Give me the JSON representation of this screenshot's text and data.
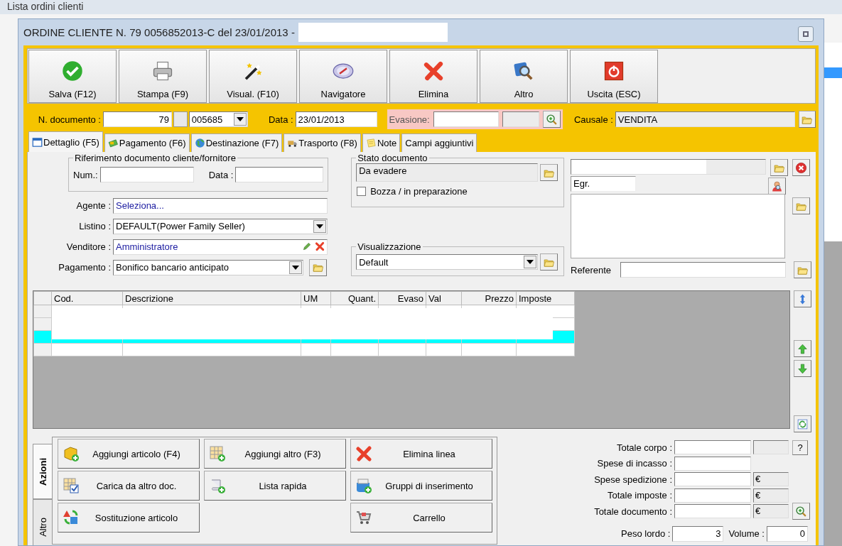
{
  "background_window": {
    "title": "Lista ordini clienti"
  },
  "window": {
    "title": "ORDINE CLIENTE N. 79 0056852013-C del 23/01/2013 -"
  },
  "toolbar": [
    {
      "label": "Salva (F12)"
    },
    {
      "label": "Stampa (F9)"
    },
    {
      "label": "Visual. (F10)"
    },
    {
      "label": "Navigatore"
    },
    {
      "label": "Elimina"
    },
    {
      "label": "Altro"
    },
    {
      "label": "Uscita (ESC)"
    }
  ],
  "header": {
    "n_documento_label": "N. documento :",
    "n_documento": "79",
    "serie": "005685",
    "data_label": "Data :",
    "data": "23/01/2013",
    "evasione_label": "Evasione:",
    "causale_label": "Causale :",
    "causale": "VENDITA"
  },
  "tabs": [
    {
      "label": "Dettaglio (F5)",
      "selected": true
    },
    {
      "label": "Pagamento (F6)",
      "selected": false
    },
    {
      "label": "Destinazione (F7)",
      "selected": false
    },
    {
      "label": "Trasporto (F8)",
      "selected": false
    },
    {
      "label": "Note",
      "selected": false
    },
    {
      "label": "Campi aggiuntivi",
      "selected": false
    }
  ],
  "riferimento": {
    "title": "Riferimento documento cliente/fornitore",
    "num_label": "Num.:",
    "data_label": "Data :"
  },
  "fields": [
    {
      "label": "Agente :",
      "value": "Seleziona...",
      "kind": "link"
    },
    {
      "label": "Listino :",
      "value": "DEFAULT(Power Family Seller)",
      "kind": "select"
    },
    {
      "label": "Venditore :",
      "value": "Amministratore",
      "kind": "edit"
    },
    {
      "label": "Pagamento :",
      "value": "Bonifico bancario anticipato",
      "kind": "select-folder"
    }
  ],
  "stato": {
    "title": "Stato documento",
    "value": "Da evadere",
    "checkbox_label": "Bozza / in preparazione",
    "checked": false
  },
  "visualizzazione": {
    "title": "Visualizzazione",
    "value": "Default"
  },
  "recipient": {
    "salutation": "Egr.",
    "referente_label": "Referente"
  },
  "table": {
    "columns": [
      "Cod.",
      "Descrizione",
      "UM",
      "Quant.",
      "Evaso",
      "Val",
      "Prezzo",
      "Imposte"
    ],
    "rows": [
      {
        "selected": false
      },
      {
        "selected": false
      },
      {
        "selected": true
      },
      {
        "selected": false
      }
    ]
  },
  "side_tabs": [
    {
      "label": "Azioni",
      "selected": true
    },
    {
      "label": "Altro",
      "selected": false
    }
  ],
  "action_columns": [
    [
      {
        "label": "Aggiungi articolo (F4)"
      },
      {
        "label": "Carica da altro doc."
      },
      {
        "label": "Sostituzione articolo"
      }
    ],
    [
      {
        "label": "Aggiungi altro (F3)"
      },
      {
        "label": "Lista rapida"
      }
    ],
    [
      {
        "label": "Elimina linea"
      },
      {
        "label": "Gruppi di inserimento"
      },
      {
        "label": "Carrello"
      }
    ]
  ],
  "totals": [
    {
      "label": "Totale corpo :",
      "kind": "help",
      "button": "?"
    },
    {
      "label": "Spese di incasso :",
      "kind": "plain"
    },
    {
      "label": "Spese spedizione :",
      "kind": "currency",
      "currency": "€"
    },
    {
      "label": "Totale imposte :",
      "kind": "currency",
      "currency": "€"
    },
    {
      "label": "Totale documento :",
      "kind": "zoom",
      "currency": "€"
    }
  ],
  "peso": {
    "label": "Peso lordo :",
    "value": "3"
  },
  "volume": {
    "label": "Volume :",
    "value": "0"
  }
}
